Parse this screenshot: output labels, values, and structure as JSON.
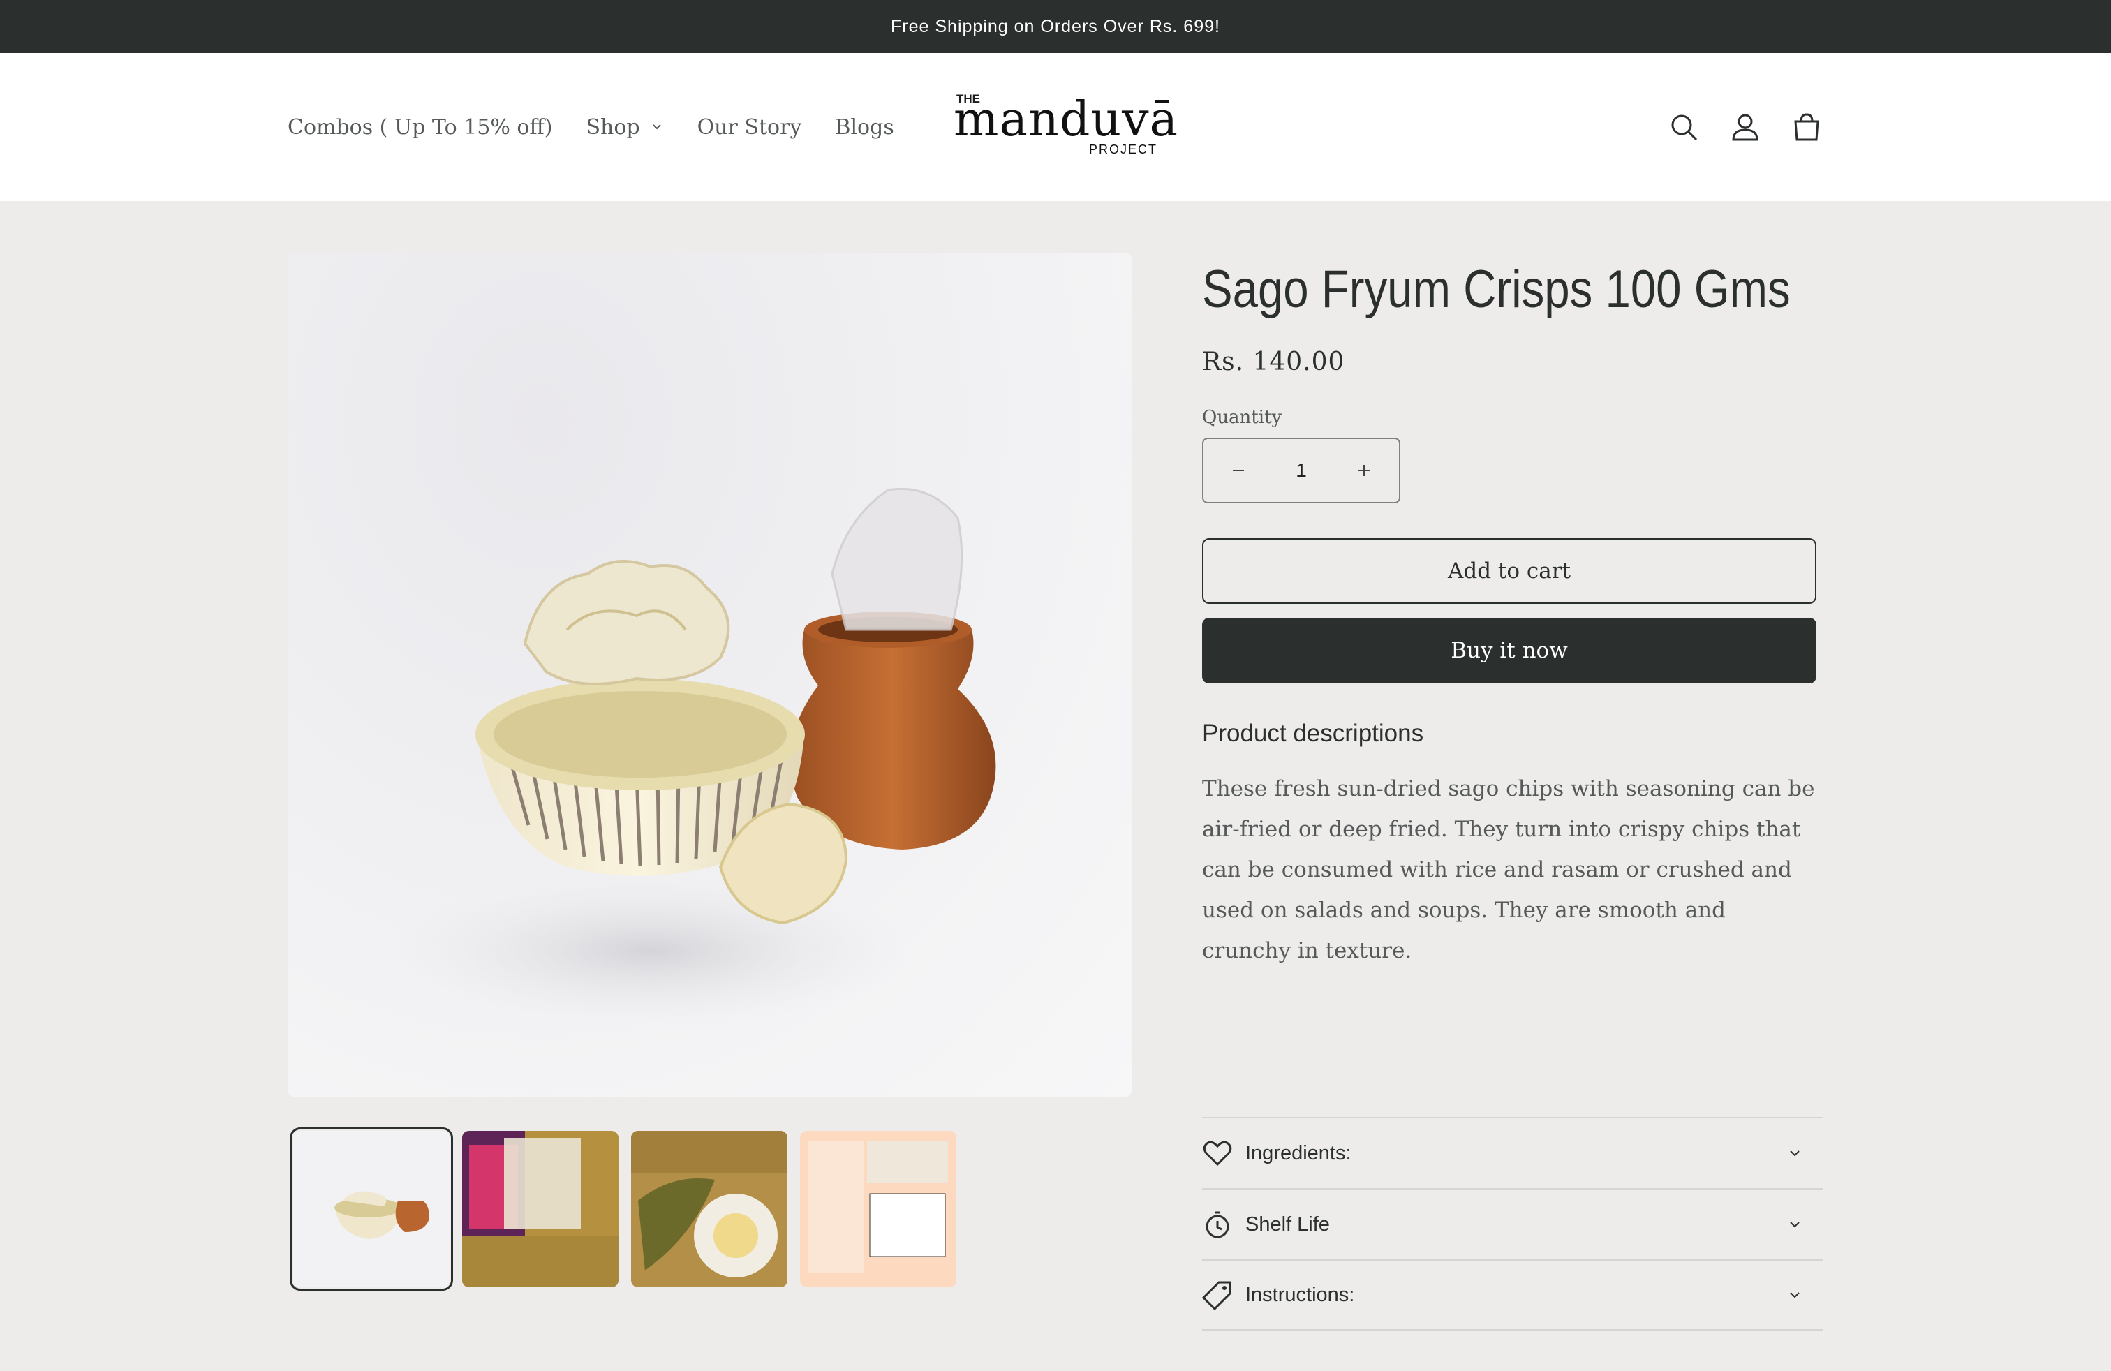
{
  "announcement": "Free Shipping on Orders Over Rs. 699!",
  "nav": {
    "items": [
      {
        "label": "Combos ( Up To 15% off)"
      },
      {
        "label": "Shop"
      },
      {
        "label": "Our Story"
      },
      {
        "label": "Blogs"
      }
    ]
  },
  "logo": {
    "the": "THE",
    "word": "manduvā",
    "project": "PROJECT"
  },
  "header_icons": [
    "search-icon",
    "account-icon",
    "cart-icon"
  ],
  "product": {
    "title": "Sago Fryum Crisps 100 Gms",
    "price": "Rs. 140.00",
    "quantity_label": "Quantity",
    "quantity": "1",
    "add_to_cart": "Add to cart",
    "buy_now": "Buy it now",
    "description_heading": "Product descriptions",
    "description": "These fresh sun-dried sago chips with seasoning can be air-fried or deep fried. They turn into crispy chips that can be consumed with rice and rasam or crushed and used on salads and soups. They are smooth and crunchy in texture."
  },
  "accordions": [
    {
      "label": "Ingredients:",
      "icon": "heart-icon"
    },
    {
      "label": "Shelf Life",
      "icon": "stopwatch-icon"
    },
    {
      "label": "Instructions:",
      "icon": "tag-icon"
    }
  ],
  "thumbnails": [
    "bowl-and-pot",
    "packet-with-chips",
    "chips-on-plate",
    "label-back"
  ],
  "colors": {
    "dark": "#2b302e",
    "background": "#edeceb",
    "pot": "#b9652f",
    "bowl": "#f1e9cf"
  }
}
